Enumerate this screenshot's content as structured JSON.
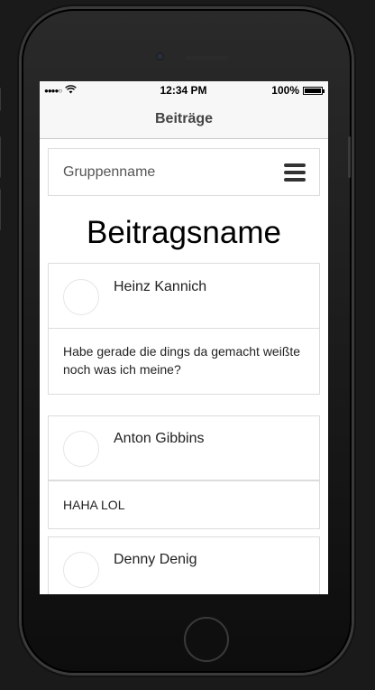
{
  "status_bar": {
    "signal": "●●●●○",
    "wifi_icon": "wifi-icon",
    "time": "12:34 PM",
    "battery": "100%"
  },
  "nav": {
    "title": "Beiträge"
  },
  "group": {
    "name": "Gruppenname",
    "menu_icon": "hamburger-icon"
  },
  "post": {
    "title": "Beitragsname"
  },
  "comments": [
    {
      "author": "Heinz Kannich",
      "text": "Habe gerade die dings da gemacht weißte noch was ich meine?"
    },
    {
      "author": "Anton Gibbins",
      "text": "HAHA LOL"
    },
    {
      "author": "Denny Denig",
      "text": ""
    }
  ]
}
